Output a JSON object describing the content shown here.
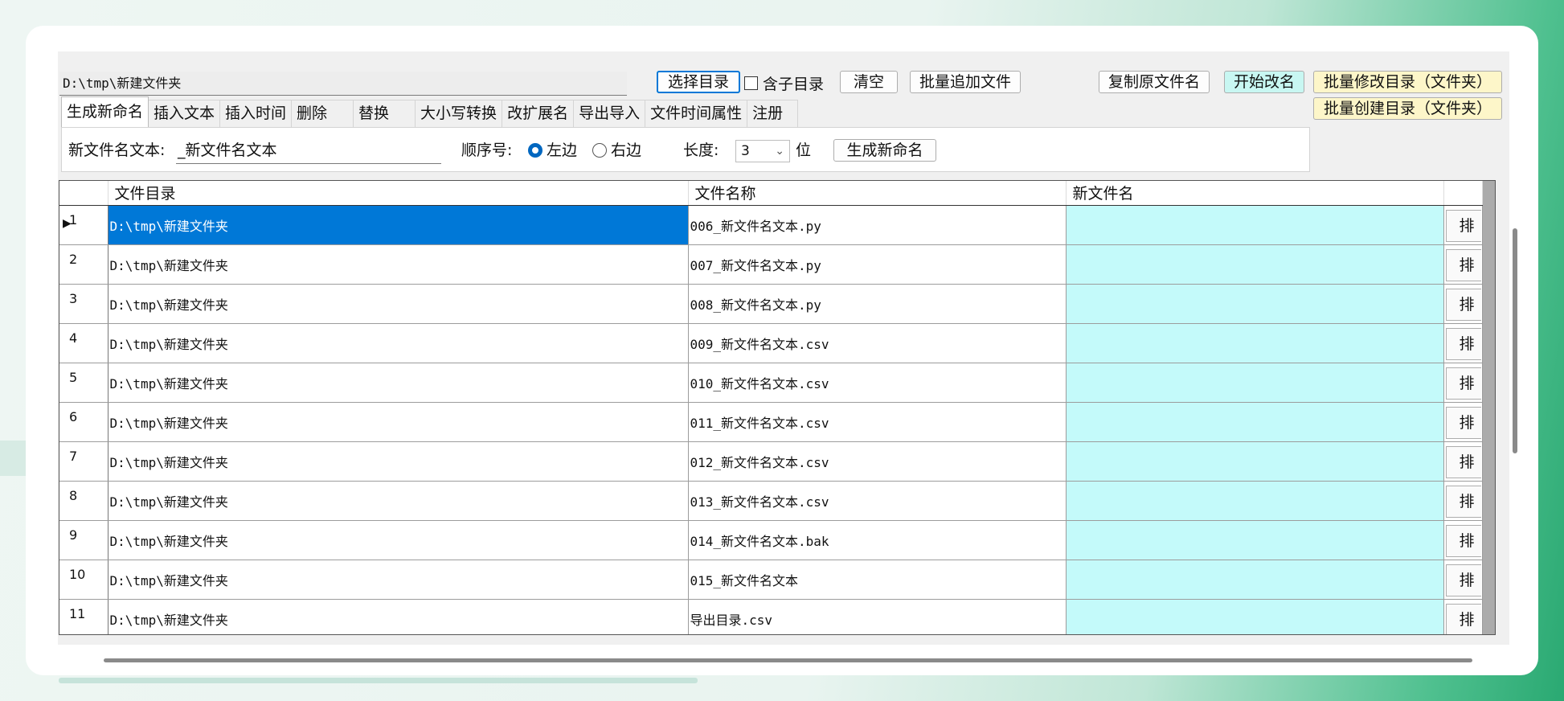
{
  "top": {
    "path_value": "D:\\tmp\\新建文件夹",
    "select_dir": "选择目录",
    "include_subdir": "含子目录",
    "clear": "清空",
    "batch_add": "批量追加文件",
    "copy_name": "复制原文件名",
    "start_rename": "开始改名",
    "batch_modify_dir": "批量修改目录（文件夹）",
    "batch_create_dir": "批量创建目录（文件夹）"
  },
  "tabs": [
    "生成新命名",
    "插入文本",
    "插入时间",
    "删除",
    "替换",
    "大小写转换",
    "改扩展名",
    "导出导入",
    "文件时间属性",
    "注册"
  ],
  "panel": {
    "new_name_label": "新文件名文本:",
    "new_name_value": "_新文件名文本",
    "seq_label": "顺序号:",
    "left": "左边",
    "right": "右边",
    "length_label": "长度:",
    "length_value": "3",
    "unit": "位",
    "generate": "生成新命名"
  },
  "table": {
    "headers": [
      "文件目录",
      "文件名称",
      "新文件名"
    ],
    "action_label": "排",
    "rows": [
      {
        "n": "1",
        "dir": "D:\\tmp\\新建文件夹",
        "name": "006_新文件名文本.py",
        "new": ""
      },
      {
        "n": "2",
        "dir": "D:\\tmp\\新建文件夹",
        "name": "007_新文件名文本.py",
        "new": ""
      },
      {
        "n": "3",
        "dir": "D:\\tmp\\新建文件夹",
        "name": "008_新文件名文本.py",
        "new": ""
      },
      {
        "n": "4",
        "dir": "D:\\tmp\\新建文件夹",
        "name": "009_新文件名文本.csv",
        "new": ""
      },
      {
        "n": "5",
        "dir": "D:\\tmp\\新建文件夹",
        "name": "010_新文件名文本.csv",
        "new": ""
      },
      {
        "n": "6",
        "dir": "D:\\tmp\\新建文件夹",
        "name": "011_新文件名文本.csv",
        "new": ""
      },
      {
        "n": "7",
        "dir": "D:\\tmp\\新建文件夹",
        "name": "012_新文件名文本.csv",
        "new": ""
      },
      {
        "n": "8",
        "dir": "D:\\tmp\\新建文件夹",
        "name": "013_新文件名文本.csv",
        "new": ""
      },
      {
        "n": "9",
        "dir": "D:\\tmp\\新建文件夹",
        "name": "014_新文件名文本.bak",
        "new": ""
      },
      {
        "n": "10",
        "dir": "D:\\tmp\\新建文件夹",
        "name": "015_新文件名文本",
        "new": ""
      },
      {
        "n": "11",
        "dir": "D:\\tmp\\新建文件夹",
        "name": "导出目录.csv",
        "new": ""
      }
    ]
  },
  "colors": {
    "selection": "#0078d7",
    "new_name_bg": "#c4fafa",
    "start_btn": "#c8f7f2",
    "dir_btn": "#fdf6c9"
  }
}
